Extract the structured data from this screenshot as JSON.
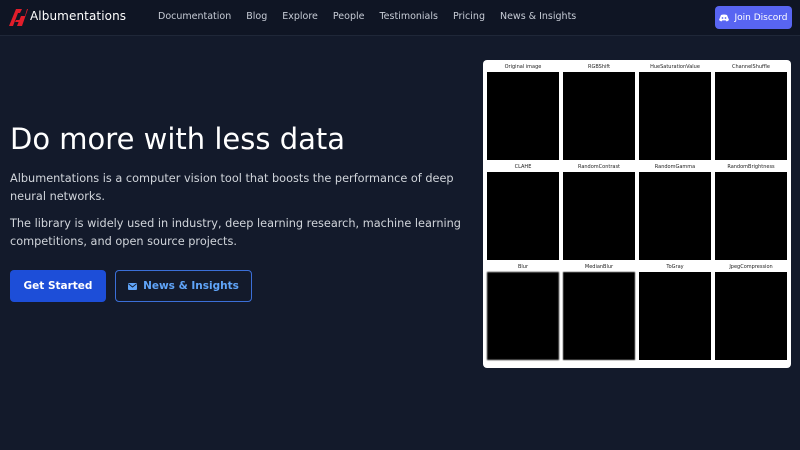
{
  "nav": {
    "brand": "Albumentations",
    "links": [
      "Documentation",
      "Blog",
      "Explore",
      "People",
      "Testimonials",
      "Pricing",
      "News & Insights"
    ],
    "discord_label": "Join Discord"
  },
  "hero": {
    "headline": "Do more with less data",
    "paragraph_1": "Albumentations is a computer vision tool that boosts the performance of deep neural networks.",
    "paragraph_2": "The library is widely used in industry, deep learning research, machine learning competitions, and open source projects.",
    "primary_button": "Get Started",
    "secondary_button": "News & Insights"
  },
  "augmentations": [
    {
      "label": "Original image",
      "variant": "original"
    },
    {
      "label": "RGBShift",
      "variant": "rgbshift"
    },
    {
      "label": "HueSaturationValue",
      "variant": "hsv"
    },
    {
      "label": "ChannelShuffle",
      "variant": "shuffle"
    },
    {
      "label": "CLAHE",
      "variant": "clahe"
    },
    {
      "label": "RandomContrast",
      "variant": "contrast"
    },
    {
      "label": "RandomGamma",
      "variant": "gamma"
    },
    {
      "label": "RandomBrightness",
      "variant": "brightness"
    },
    {
      "label": "Blur",
      "variant": "blur"
    },
    {
      "label": "MedianBlur",
      "variant": "median"
    },
    {
      "label": "ToGray",
      "variant": "gray"
    },
    {
      "label": "JpegCompression",
      "variant": "jpeg"
    }
  ],
  "colors": {
    "background": "#131a2b",
    "navbar": "#0f1524",
    "discord": "#5865f2",
    "primary": "#1d4ed8",
    "outline": "#60a5fa",
    "logo_red": "#e11d2a"
  }
}
